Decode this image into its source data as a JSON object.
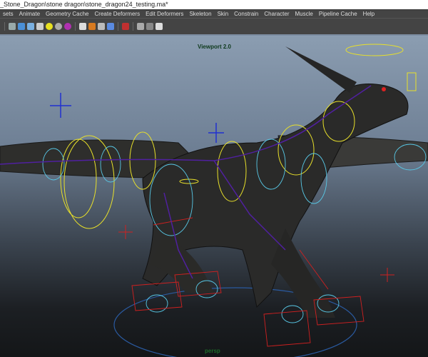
{
  "window": {
    "title": "_Stone_Dragon\\stone dragon\\stone_dragon24_testing.ma*"
  },
  "menu": [
    "sets",
    "Animate",
    "Geometry Cache",
    "Create Deformers",
    "Edit Deformers",
    "Skeleton",
    "Skin",
    "Constrain",
    "Character",
    "Muscle",
    "Pipeline Cache",
    "Help"
  ],
  "toolbar": {
    "icons": [
      "wireframe-icon",
      "smooth-shade-icon",
      "shade-wire-icon",
      "textured-icon",
      "lights-default-icon",
      "lights-all-icon",
      "lights-selected-icon",
      "camera-icon",
      "shadows-icon",
      "ambient-occlusion-icon",
      "motion-blur-icon",
      "isolate-select-icon",
      "xray-icon",
      "xray-joints-icon",
      "share-icon"
    ],
    "colors": [
      "#9aa",
      "#4a8fd6",
      "#7ab0e0",
      "#ccc",
      "#e8e020",
      "#aaa",
      "#b030b0",
      "#ddd",
      "#d77a20",
      "#bbb",
      "#5a8ae0",
      "#c03030",
      "#aaa",
      "#888",
      "#ddd"
    ]
  },
  "viewport": {
    "renderer_label": "Viewport 2.0",
    "camera_label": "persp"
  }
}
